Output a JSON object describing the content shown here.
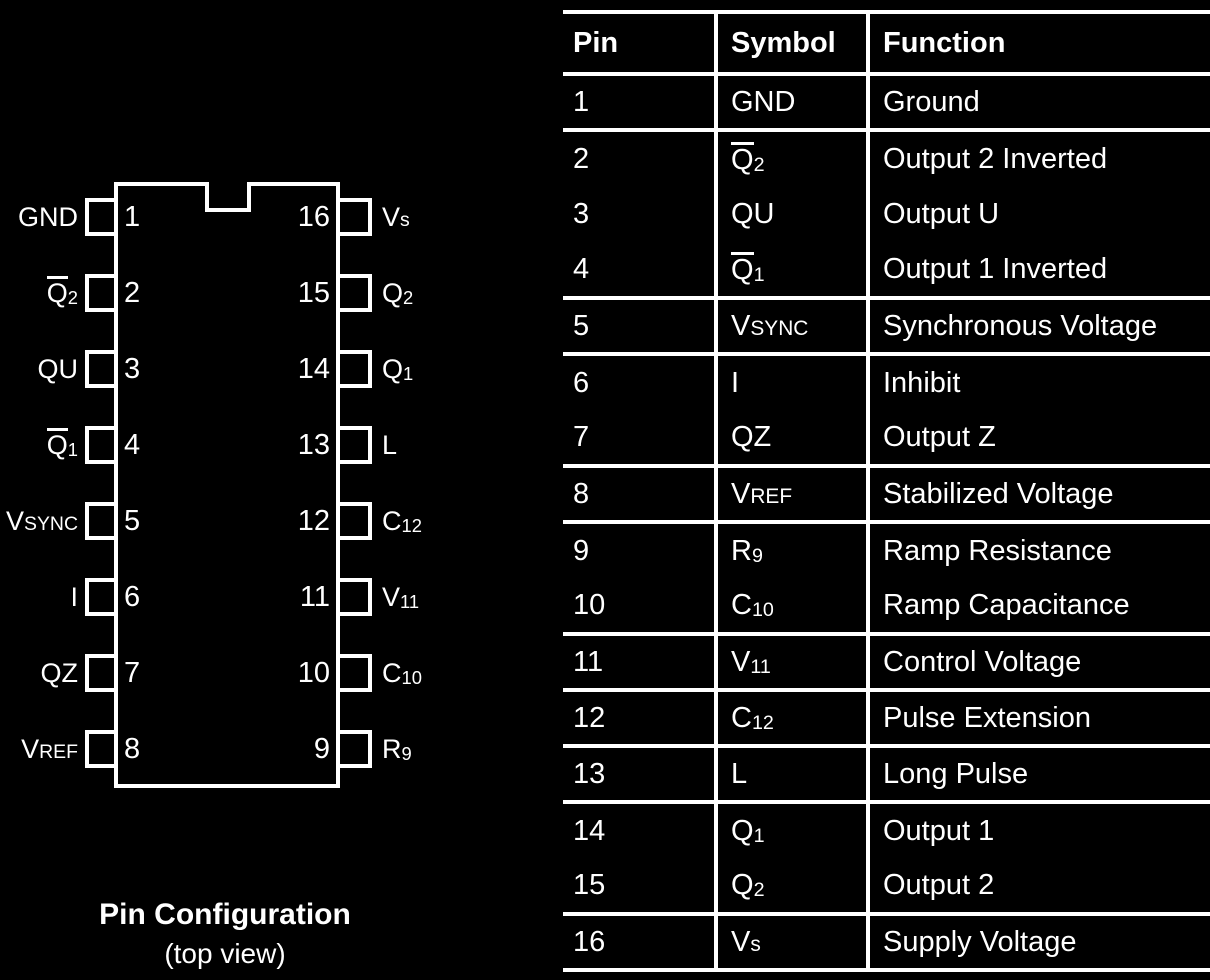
{
  "diagram": {
    "caption_title": "Pin Configuration",
    "caption_subtitle": "(top view)",
    "package_pin_count": 16,
    "left_pins": [
      {
        "number": "1",
        "label": "GND",
        "overline": false
      },
      {
        "number": "2",
        "label": "Q2",
        "overline": true
      },
      {
        "number": "3",
        "label": "QU",
        "overline": false
      },
      {
        "number": "4",
        "label": "Q1",
        "overline": true
      },
      {
        "number": "5",
        "label": "VSYNC",
        "overline": false
      },
      {
        "number": "6",
        "label": "I",
        "overline": false
      },
      {
        "number": "7",
        "label": "QZ",
        "overline": false
      },
      {
        "number": "8",
        "label": "VREF",
        "overline": false
      }
    ],
    "right_pins": [
      {
        "number": "16",
        "label": "Vs",
        "overline": false
      },
      {
        "number": "15",
        "label": "Q2",
        "overline": false
      },
      {
        "number": "14",
        "label": "Q1",
        "overline": false
      },
      {
        "number": "13",
        "label": "L",
        "overline": false
      },
      {
        "number": "12",
        "label": "C12",
        "overline": false
      },
      {
        "number": "11",
        "label": "V11",
        "overline": false
      },
      {
        "number": "10",
        "label": "C10",
        "overline": false
      },
      {
        "number": "9",
        "label": "R9",
        "overline": false
      }
    ]
  },
  "table": {
    "headers": [
      "Pin",
      "Symbol",
      "Function"
    ],
    "rows": [
      {
        "pin": "1",
        "symbol": "GND",
        "function": "Ground",
        "group_start": true
      },
      {
        "pin": "2",
        "symbol": "Q2",
        "function": "Output 2 Inverted",
        "group_start": true
      },
      {
        "pin": "3",
        "symbol": "QU",
        "function": "Output U",
        "group_start": false
      },
      {
        "pin": "4",
        "symbol": "Q1",
        "function": "Output 1 Inverted",
        "group_start": false
      },
      {
        "pin": "5",
        "symbol": "VSYNC",
        "function": "Synchronous Voltage",
        "group_start": true
      },
      {
        "pin": "6",
        "symbol": "I",
        "function": "Inhibit",
        "group_start": true
      },
      {
        "pin": "7",
        "symbol": "QZ",
        "function": "Output Z",
        "group_start": false
      },
      {
        "pin": "8",
        "symbol": "VREF",
        "function": "Stabilized Voltage",
        "group_start": true
      },
      {
        "pin": "9",
        "symbol": "R9",
        "function": "Ramp Resistance",
        "group_start": true
      },
      {
        "pin": "10",
        "symbol": "C10",
        "function": "Ramp Capacitance",
        "group_start": false
      },
      {
        "pin": "11",
        "symbol": "V11",
        "function": "Control Voltage",
        "group_start": true
      },
      {
        "pin": "12",
        "symbol": "C12",
        "function": "Pulse Extension",
        "group_start": true
      },
      {
        "pin": "13",
        "symbol": "L",
        "function": "Long Pulse",
        "group_start": true
      },
      {
        "pin": "14",
        "symbol": "Q1",
        "function": "Output 1",
        "group_start": true
      },
      {
        "pin": "15",
        "symbol": "Q2",
        "function": "Output 2",
        "group_start": false
      },
      {
        "pin": "16",
        "symbol": "Vs",
        "function": "Supply Voltage",
        "group_start": true
      }
    ]
  },
  "colors": {
    "background": "#000000",
    "foreground": "#ffffff"
  }
}
